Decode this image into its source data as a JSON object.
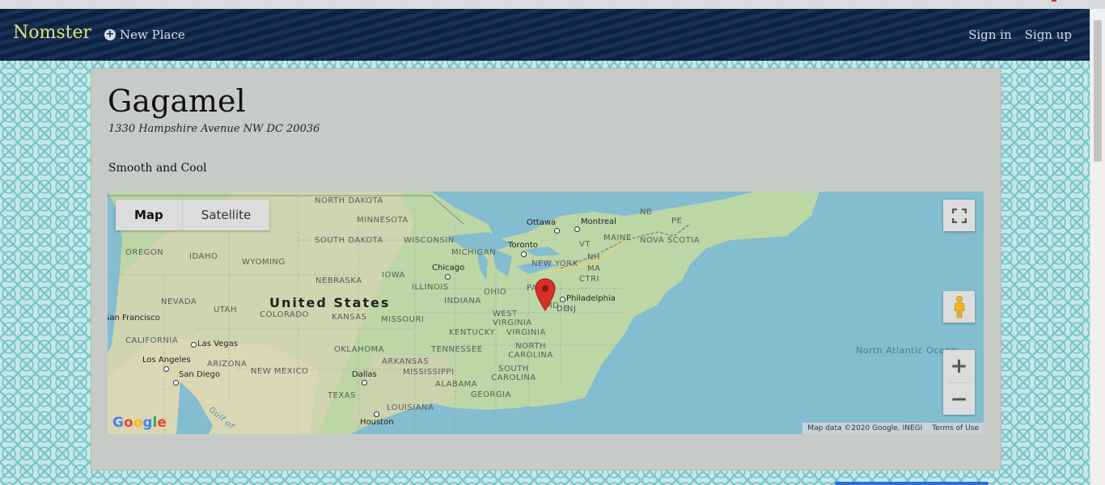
{
  "navbar": {
    "brand": "Nomster",
    "new_place": "New Place",
    "sign_in": "Sign in",
    "sign_up": "Sign up"
  },
  "place": {
    "name": "Gagamel",
    "address": "1330 Hampshire Avenue NW DC 20036",
    "description": "Smooth and Cool"
  },
  "map": {
    "type_tabs": [
      "Map",
      "Satellite"
    ],
    "selected_type": "Map",
    "country_label": "United States",
    "state_labels": [
      "NORTH DAKOTA",
      "MINNESOTA",
      "SOUTH DAKOTA",
      "WISCONSIN",
      "MICHIGAN",
      "OREGON",
      "IDAHO",
      "WYOMING",
      "NEBRASKA",
      "IOWA",
      "ILLINOIS",
      "OHIO",
      "NEVADA",
      "UTAH",
      "COLORADO",
      "KANSAS",
      "MISSOURI",
      "INDIANA",
      "WEST VIRGINIA",
      "VIRGINIA",
      "KENTUCKY",
      "CALIFORNIA",
      "ARIZONA",
      "NEW MEXICO",
      "OKLAHOMA",
      "ARKANSAS",
      "TENNESSEE",
      "NORTH CAROLINA",
      "SOUTH CAROLINA",
      "MISSISSIPPI",
      "ALABAMA",
      "GEORGIA",
      "TEXAS",
      "LOUISIANA",
      "NEW YORK",
      "VT",
      "NH",
      "MA",
      "CTRI",
      "MAINE",
      "NB",
      "PE",
      "NOVA SCOTIA",
      "PA",
      "DE",
      "NJ",
      "MD"
    ],
    "city_labels": [
      "Ottawa",
      "Montreal",
      "Toronto",
      "Chicago",
      "Philadelphia",
      "San Francisco",
      "Las Vegas",
      "Los Angeles",
      "San Diego",
      "Dallas",
      "Houston"
    ],
    "ocean_label": "North Atlantic Ocean",
    "gulf_label": "Gulf of",
    "google_logo": "Google",
    "attribution": "Map data ©2020 Google, INEGI",
    "terms": "Terms of Use",
    "marker_color": "#d93025",
    "controls": [
      "fullscreen-icon",
      "pegman-icon",
      "zoom-in-icon",
      "zoom-out-icon"
    ]
  },
  "colors": {
    "navbar": "#0e2240",
    "brand": "#e3e47a",
    "card": "#c7cbc7",
    "water": "#84bcd0"
  }
}
